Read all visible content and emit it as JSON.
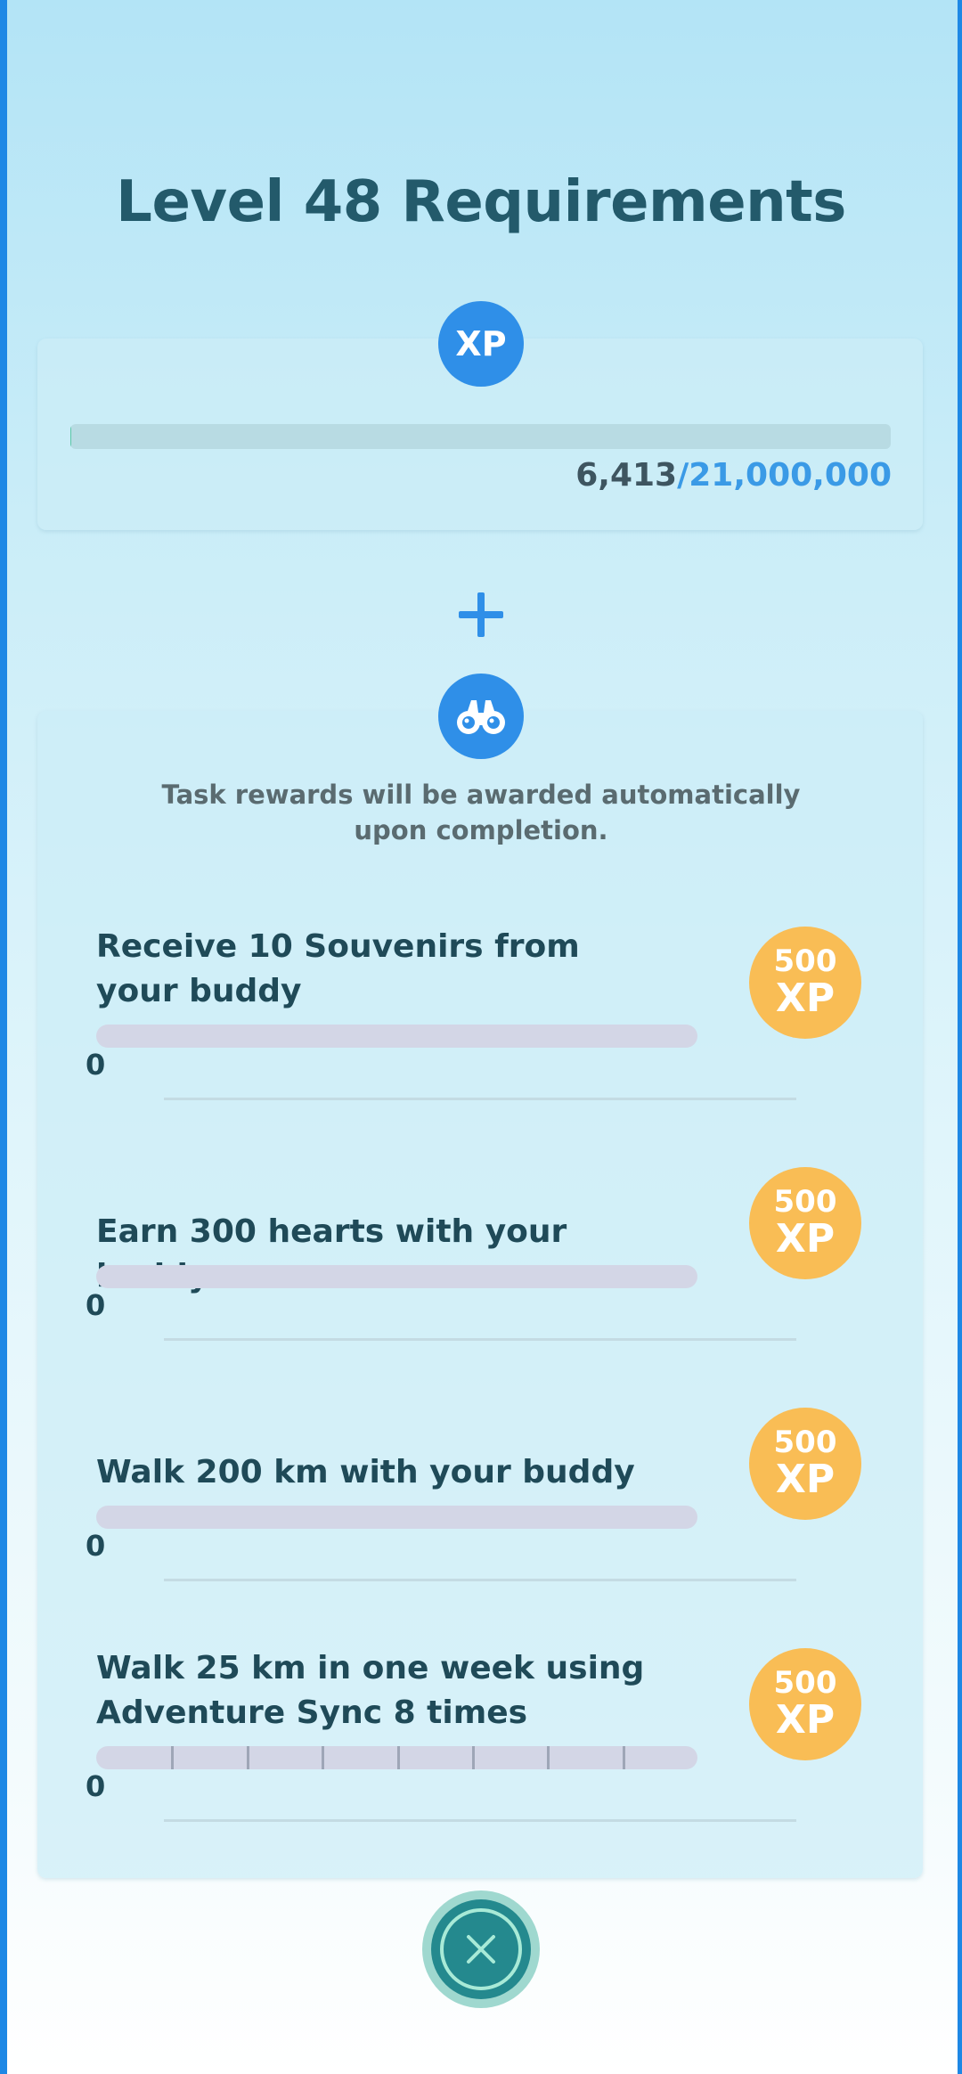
{
  "page": {
    "title": "Level 48 Requirements",
    "colors": {
      "accent": "#2f8fe8",
      "title": "#235a6b",
      "reward": "#f9bd55",
      "close": "#24898e"
    }
  },
  "xp": {
    "badge_label": "XP",
    "current": "6,413",
    "goal": "/21,000,000",
    "progress_fraction": 0.0003
  },
  "plus_icon": "plus-icon",
  "tasks_section": {
    "icon": "binoculars-icon",
    "note": "Task rewards will be awarded automatically upon completion.",
    "tasks": [
      {
        "text": "Receive 10 Souvenirs from your buddy",
        "count": "0",
        "progress_fraction": 0,
        "reward_amount": "500",
        "reward_unit": "XP"
      },
      {
        "text": "Earn 300 hearts with your buddy",
        "count": "0",
        "progress_fraction": 0,
        "reward_amount": "500",
        "reward_unit": "XP"
      },
      {
        "text": "Walk 200 km with your buddy",
        "count": "0",
        "progress_fraction": 0,
        "reward_amount": "500",
        "reward_unit": "XP"
      },
      {
        "text": "Walk 25 km in one week using Adventure Sync 8 times",
        "count": "0",
        "progress_fraction": 0,
        "segments": 8,
        "reward_amount": "500",
        "reward_unit": "XP"
      }
    ]
  },
  "close_button": {
    "icon": "close-icon"
  }
}
